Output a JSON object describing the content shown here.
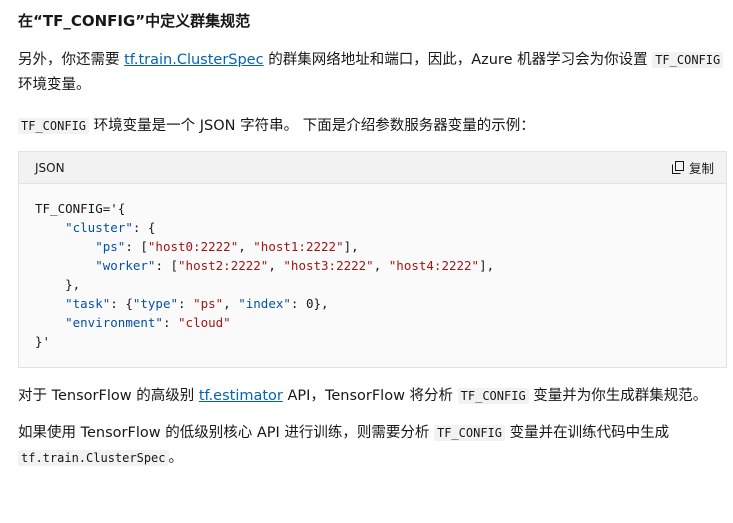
{
  "heading": "在“TF_CONFIG”中定义群集规范",
  "para1": {
    "t1": "另外，你还需要 ",
    "link": "tf.train.ClusterSpec",
    "t2": " 的群集网络地址和端口，因此，Azure 机器学习会为你设置 ",
    "code": "TF_CONFIG",
    "t3": " 环境变量。"
  },
  "para2": {
    "code": "TF_CONFIG",
    "t1": " 环境变量是一个 JSON 字符串。 下面是介绍参数服务器变量的示例："
  },
  "codeblock": {
    "language": "JSON",
    "copy_label": "复制",
    "lines": {
      "l1": "TF_CONFIG='{",
      "l2_indent": "    ",
      "l2_key": "\"cluster\"",
      "l2_rest": ": {",
      "l3_indent": "        ",
      "l3_key": "\"ps\"",
      "l3_mid": ": [",
      "l3_v1": "\"host0:2222\"",
      "l3_sep": ", ",
      "l3_v2": "\"host1:2222\"",
      "l3_end": "],",
      "l4_indent": "        ",
      "l4_key": "\"worker\"",
      "l4_mid": ": [",
      "l4_v1": "\"host2:2222\"",
      "l4_sep1": ", ",
      "l4_v2": "\"host3:2222\"",
      "l4_sep2": ", ",
      "l4_v3": "\"host4:2222\"",
      "l4_end": "],",
      "l5": "    },",
      "l6_indent": "    ",
      "l6_key": "\"task\"",
      "l6_mid1": ": {",
      "l6_k2": "\"type\"",
      "l6_mid2": ": ",
      "l6_v2": "\"ps\"",
      "l6_mid3": ", ",
      "l6_k3": "\"index\"",
      "l6_mid4": ": 0},",
      "l7_indent": "    ",
      "l7_key": "\"environment\"",
      "l7_mid": ": ",
      "l7_val": "\"cloud\"",
      "l8": "}'"
    }
  },
  "para3": {
    "t1": "对于 TensorFlow 的高级别 ",
    "link": "tf.estimator",
    "t2": " API，TensorFlow 将分析 ",
    "code": "TF_CONFIG",
    "t3": " 变量并为你生成群集规范。"
  },
  "para4": {
    "t1": "如果使用 TensorFlow 的低级别核心 API 进行训练，则需要分析 ",
    "code1": "TF_CONFIG",
    "t2": " 变量并在训练代码中生成 ",
    "code2": "tf.train.ClusterSpec",
    "t3": "。"
  },
  "colors": {
    "link": "#0065b3",
    "string": "#a31515",
    "key": "#0451a5",
    "code_bg": "#fafafa",
    "header_bg": "#f2f2f2"
  },
  "icons": {
    "copy": "copy-icon"
  }
}
